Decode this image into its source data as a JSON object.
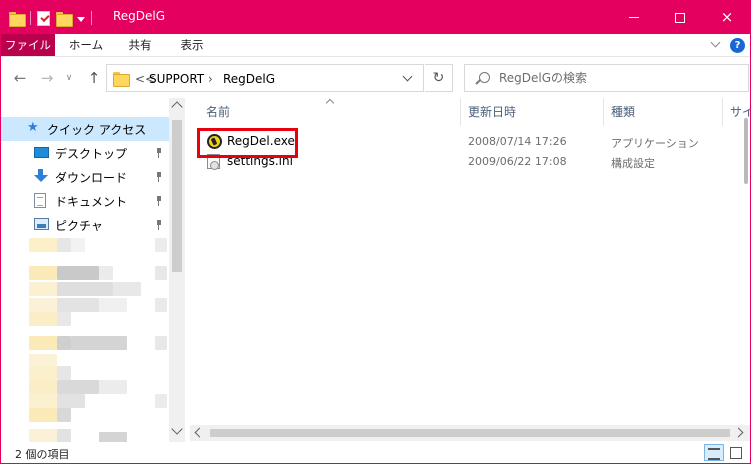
{
  "window": {
    "title": "RegDelG",
    "accent_color": "#e3005e",
    "controls": {
      "minimize": "minimize",
      "maximize": "maximize",
      "close": "×"
    }
  },
  "ribbon": {
    "tabs": [
      {
        "label": "ファイル",
        "active": true
      },
      {
        "label": "ホーム"
      },
      {
        "label": "共有"
      },
      {
        "label": "表示"
      }
    ],
    "help": "?"
  },
  "navbar": {
    "back": "←",
    "forward": "→",
    "recent": "∨",
    "up": "↑",
    "path_overflow": "<<",
    "path": [
      "SUPPORT",
      "RegDelG"
    ],
    "separator": "›",
    "refresh": "↻",
    "search_placeholder": "RegDelGの検索"
  },
  "nav_pane": {
    "quick_access": "クイック アクセス",
    "items": [
      {
        "label": "デスクトップ",
        "icon": "desktop-icon"
      },
      {
        "label": "ダウンロード",
        "icon": "download-icon"
      },
      {
        "label": "ドキュメント",
        "icon": "document-icon"
      },
      {
        "label": "ピクチャ",
        "icon": "pictures-icon"
      }
    ]
  },
  "file_list": {
    "columns": {
      "name": "名前",
      "date": "更新日時",
      "type": "種類",
      "size": "サイ"
    },
    "rows": [
      {
        "name": "RegDel.exe",
        "date": "2008/07/14 17:26",
        "type": "アプリケーション",
        "icon": "exe-app-icon"
      },
      {
        "name": "settings.ini",
        "date": "2009/06/22 17:08",
        "type": "構成設定",
        "icon": "ini-settings-icon"
      }
    ],
    "highlight_color": "#e8000d"
  },
  "status_bar": {
    "text": "2 個の項目"
  }
}
